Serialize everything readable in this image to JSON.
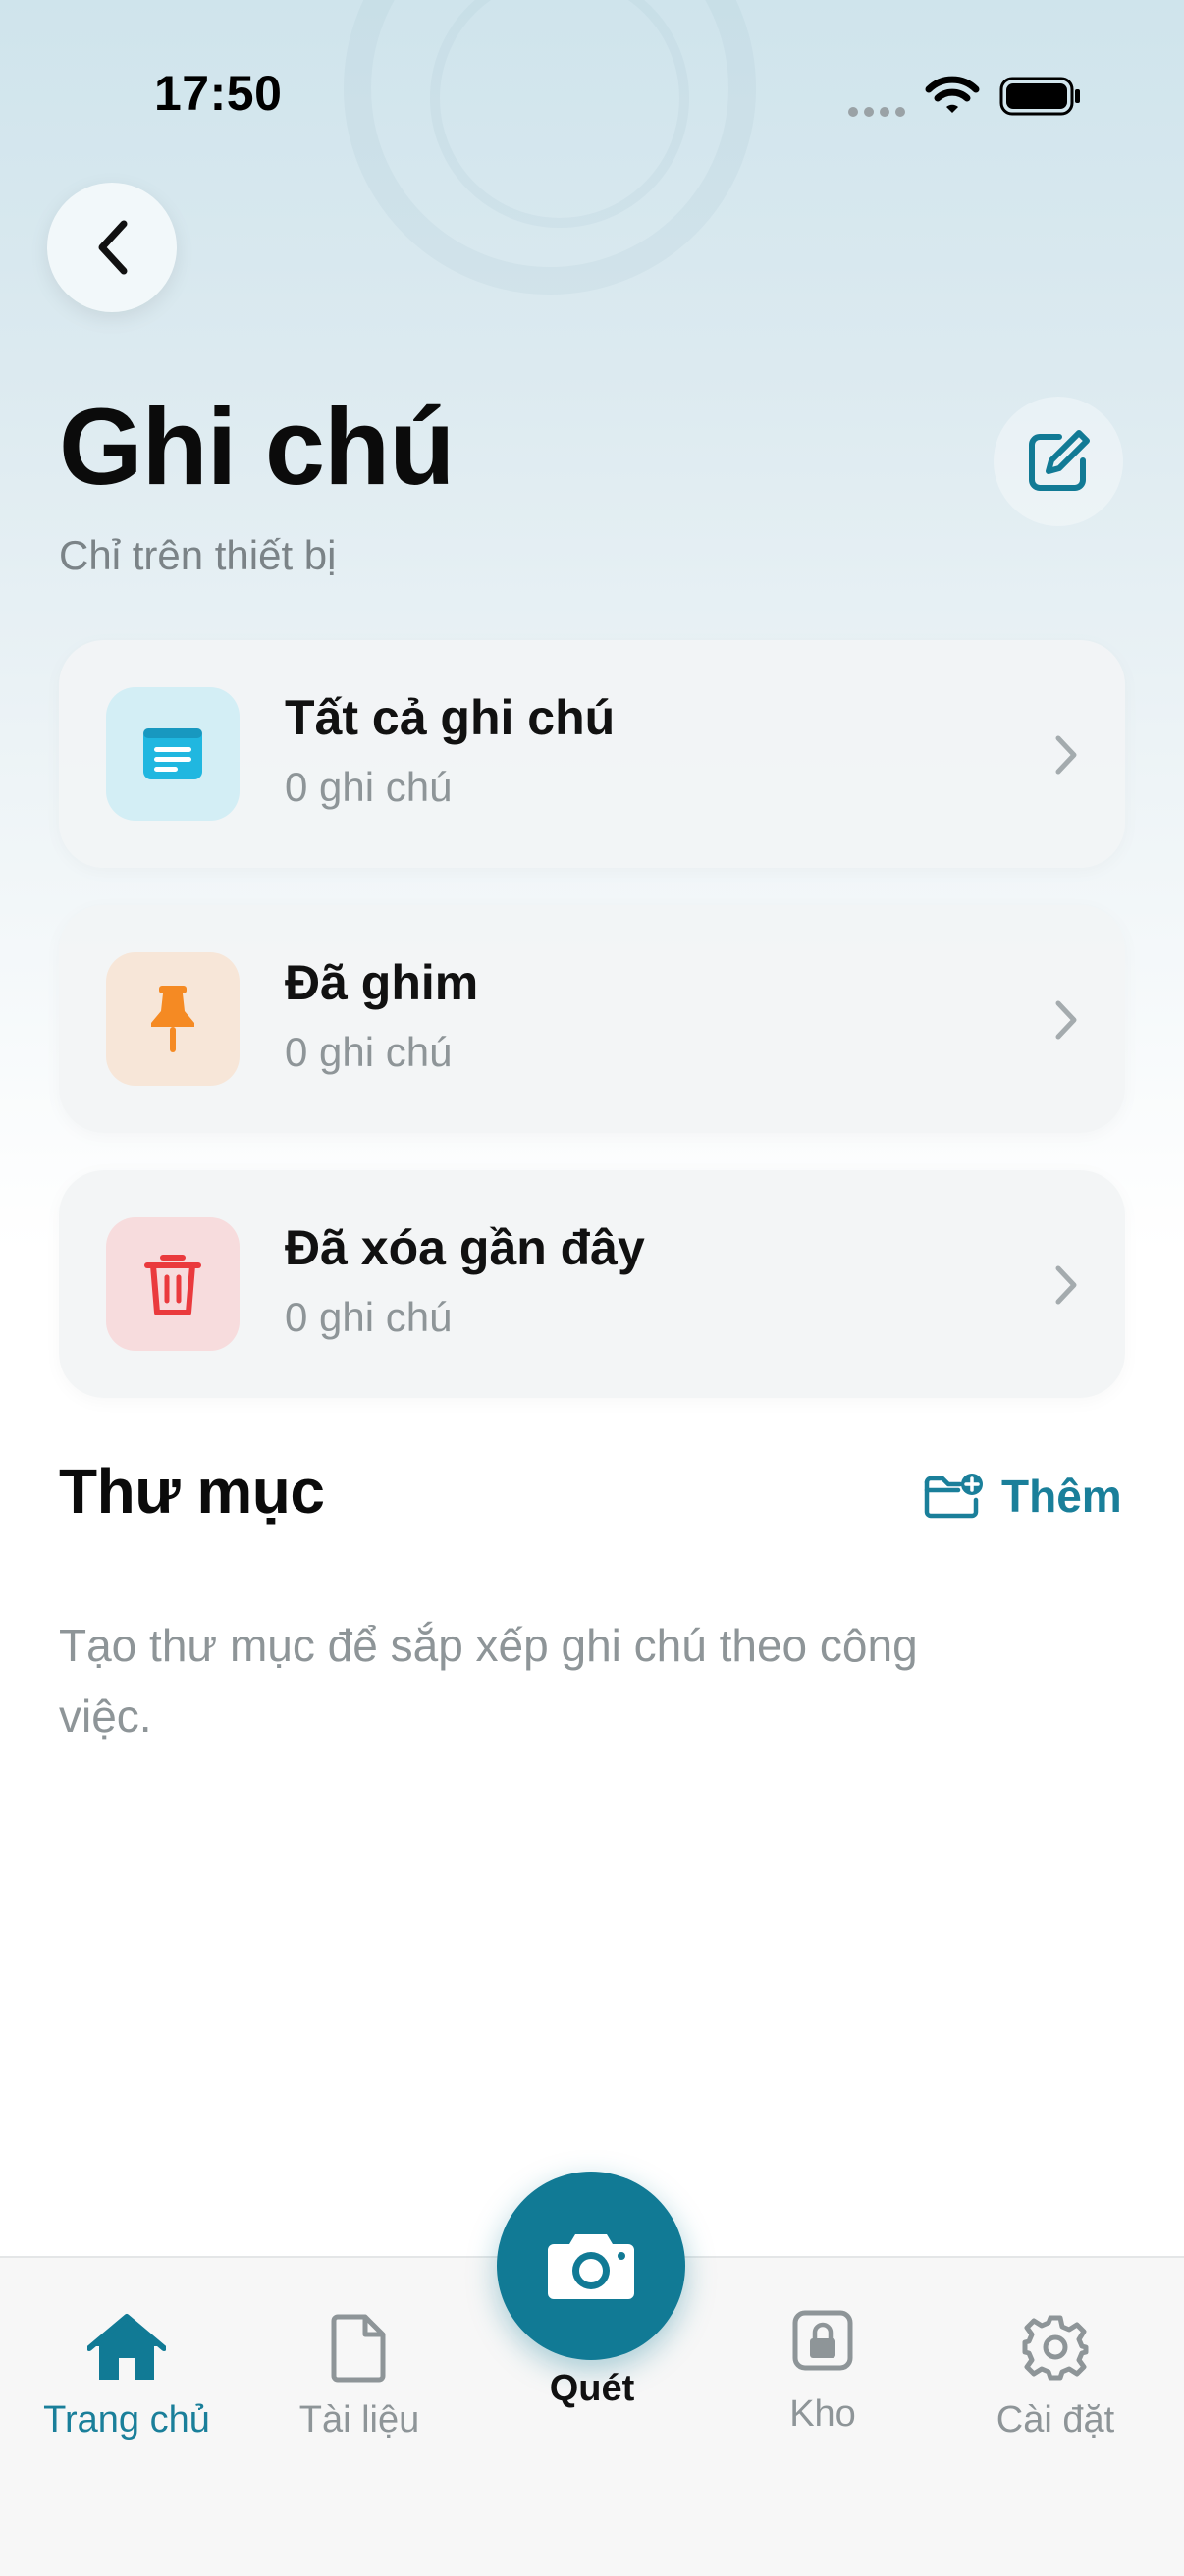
{
  "status_bar": {
    "time": "17:50"
  },
  "header": {
    "title": "Ghi chú",
    "subtitle": "Chỉ trên thiết bị"
  },
  "cards": [
    {
      "title": "Tất cả ghi chú",
      "count": "0 ghi chú",
      "icon": "note-list-icon",
      "icon_bg": "#d3eef5",
      "icon_color": "#20b7e0"
    },
    {
      "title": "Đã ghim",
      "count": "0 ghi chú",
      "icon": "pin-icon",
      "icon_bg": "#f7e6d8",
      "icon_color": "#f58a23"
    },
    {
      "title": "Đã xóa gần đây",
      "count": "0 ghi chú",
      "icon": "trash-icon",
      "icon_bg": "#f7dcdd",
      "icon_color": "#ea3a3d"
    }
  ],
  "folders": {
    "title": "Thư mục",
    "add_label": "Thêm",
    "empty_text": "Tạo thư mục để sắp xếp ghi chú theo công việc."
  },
  "tabbar": {
    "tabs": [
      {
        "label": "Trang chủ",
        "icon": "home-icon",
        "active": true
      },
      {
        "label": "Tài liệu",
        "icon": "document-icon",
        "active": false
      },
      {
        "label": "Kho",
        "icon": "lock-icon",
        "active": false
      },
      {
        "label": "Cài đặt",
        "icon": "gear-icon",
        "active": false
      }
    ],
    "scan_label": "Quét"
  },
  "colors": {
    "accent": "#117a95",
    "accent_text": "#1a7f9a",
    "muted_text": "#8e9598"
  }
}
